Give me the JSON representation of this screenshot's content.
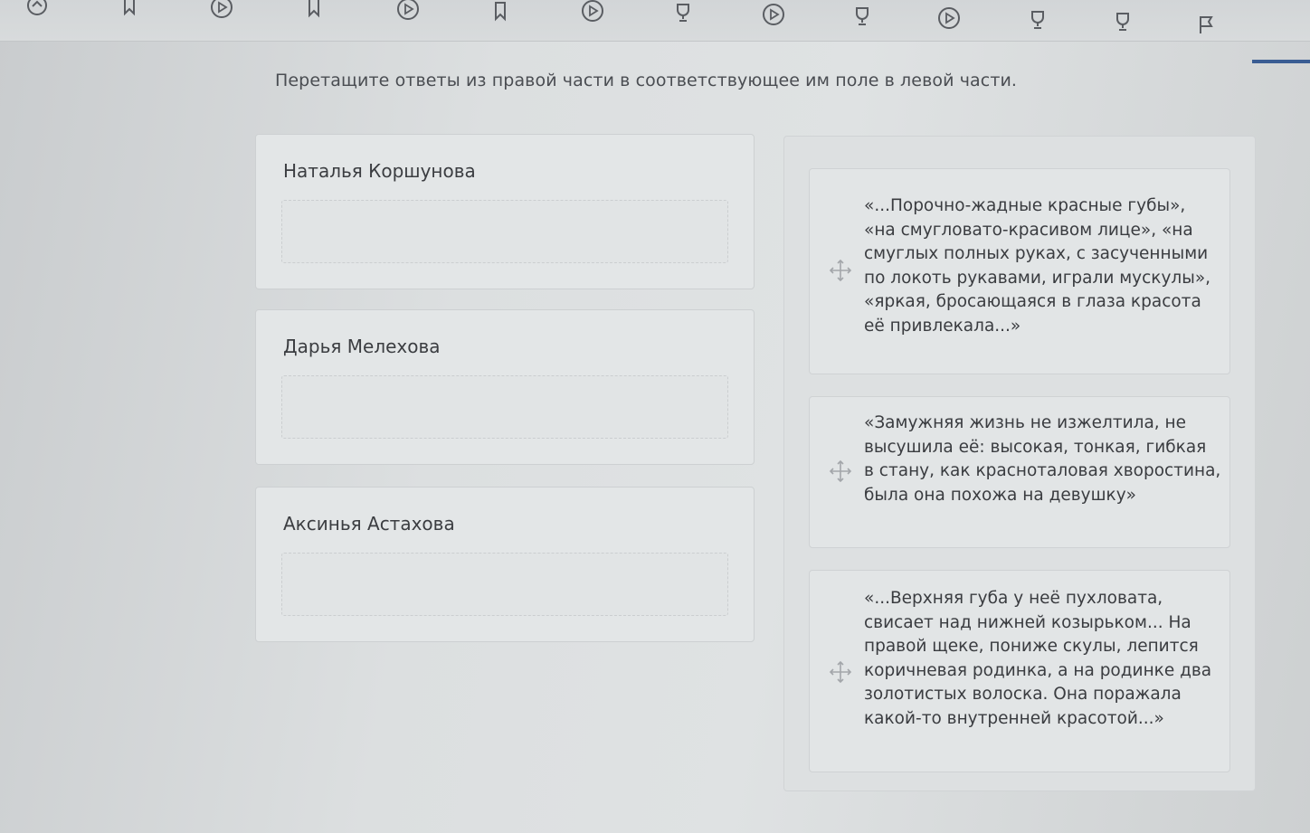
{
  "toolbar": {
    "icons": [
      "circle-arrow-icon",
      "bookmark-icon",
      "play-circle-icon",
      "bookmark-icon",
      "play-circle-icon",
      "bookmark-icon",
      "play-circle-icon",
      "trophy-icon",
      "play-circle-icon",
      "trophy-icon",
      "play-circle-icon",
      "trophy-icon",
      "trophy-icon",
      "flag-icon"
    ]
  },
  "instruction": "Перетащите ответы из правой части в соответствующее им поле в левой части.",
  "targets": [
    {
      "label": "Наталья Коршунова"
    },
    {
      "label": "Дарья Мелехова"
    },
    {
      "label": "Аксинья Астахова"
    }
  ],
  "answers": [
    {
      "text": "«...Порочно-жадные красные губы», «на смугловато-красивом лице», «на смуглых полных руках, с засученными по локоть рукавами, играли мускулы», «яркая, бросающаяся в глаза красота её привлекала...»"
    },
    {
      "text": "«Замужняя жизнь не изжелтила, не высушила её: высокая, тонкая, гибкая в стану, как красноталовая хворостина, была она похожа на девушку»"
    },
    {
      "text": "«...Верхняя губа у неё пухловата, свисает над нижней козырьком... На правой щеке, пониже скулы, лепится коричневая родинка, а на родинке два золотистых волоска. Она поражала какой-то внутренней красотой...»"
    }
  ],
  "colors": {
    "accent": "#3a5d93",
    "text": "#3a3c40",
    "icon": "#5a5d62"
  }
}
